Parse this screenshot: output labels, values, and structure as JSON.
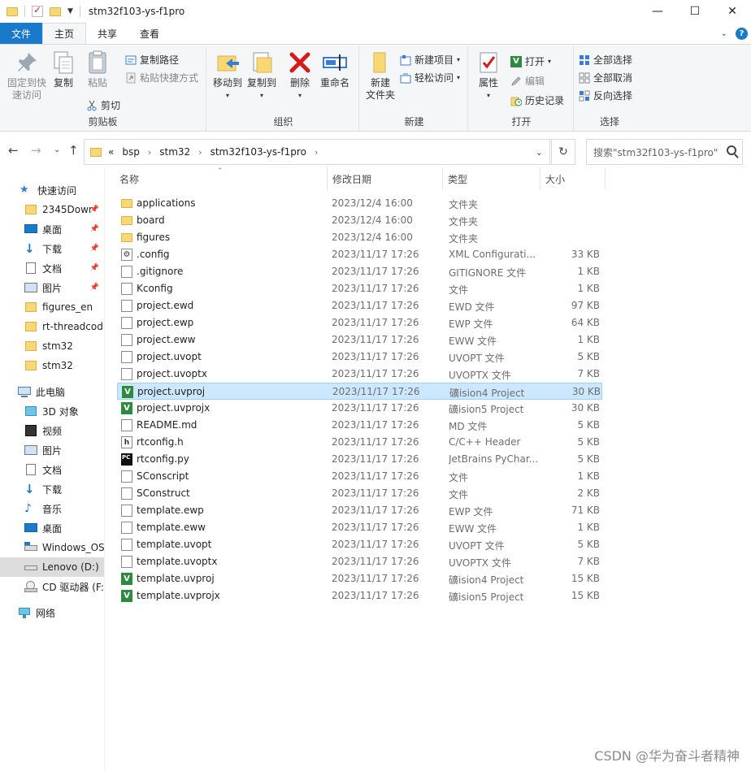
{
  "window": {
    "title": "stm32f103-ys-f1pro",
    "minimize": "—",
    "maximize": "☐",
    "close": "✕"
  },
  "ribbon_tabs": [
    {
      "label": "文件"
    },
    {
      "label": "主页"
    },
    {
      "label": "共享"
    },
    {
      "label": "查看"
    }
  ],
  "ribbon": {
    "clipboard": {
      "label": "剪贴板",
      "pin": "固定到快\n速访问",
      "copy": "复制",
      "paste": "粘贴",
      "copy_path": "复制路径",
      "paste_shortcut": "粘贴快捷方式",
      "cut": "剪切"
    },
    "organize": {
      "label": "组织",
      "move_to": "移动到",
      "copy_to": "复制到",
      "delete": "删除",
      "rename": "重命名"
    },
    "new": {
      "label": "新建",
      "new_folder": "新建\n文件夹",
      "new_item": "新建项目",
      "easy_access": "轻松访问"
    },
    "open": {
      "label": "打开",
      "properties": "属性",
      "open": "打开",
      "edit": "编辑",
      "history": "历史记录"
    },
    "select": {
      "label": "选择",
      "select_all": "全部选择",
      "select_none": "全部取消",
      "invert": "反向选择"
    }
  },
  "address": {
    "prefix": "«",
    "crumbs": [
      "bsp",
      "stm32",
      "stm32f103-ys-f1pro"
    ],
    "search_placeholder": "搜索\"stm32f103-ys-f1pro\""
  },
  "nav": {
    "items": [
      {
        "label": "快速访问",
        "icon": "star-icon",
        "pinned": false
      },
      {
        "label": "2345Dowr",
        "icon": "folder-icon",
        "pinned": true
      },
      {
        "label": "桌面",
        "icon": "desktop-icon",
        "pinned": true
      },
      {
        "label": "下载",
        "icon": "download-icon",
        "pinned": true
      },
      {
        "label": "文档",
        "icon": "documents-icon",
        "pinned": true
      },
      {
        "label": "图片",
        "icon": "pictures-icon",
        "pinned": true
      },
      {
        "label": "figures_en",
        "icon": "folder-icon",
        "pinned": false
      },
      {
        "label": "rt-threadcod",
        "icon": "folder-icon",
        "pinned": false
      },
      {
        "label": "stm32",
        "icon": "folder-icon",
        "pinned": false
      },
      {
        "label": "stm32",
        "icon": "folder-icon",
        "pinned": false
      },
      {
        "label": "此电脑",
        "icon": "computer-icon",
        "pinned": false
      },
      {
        "label": "3D 对象",
        "icon": "3d-objects-icon",
        "pinned": false
      },
      {
        "label": "视频",
        "icon": "video-icon",
        "pinned": false
      },
      {
        "label": "图片",
        "icon": "pictures-icon",
        "pinned": false
      },
      {
        "label": "文档",
        "icon": "documents-icon",
        "pinned": false
      },
      {
        "label": "下载",
        "icon": "download-icon",
        "pinned": false
      },
      {
        "label": "音乐",
        "icon": "music-icon",
        "pinned": false
      },
      {
        "label": "桌面",
        "icon": "desktop-icon",
        "pinned": false
      },
      {
        "label": "Windows_OS",
        "icon": "drive-icon",
        "pinned": false
      },
      {
        "label": "Lenovo (D:)",
        "icon": "drive-icon",
        "pinned": false
      },
      {
        "label": "CD 驱动器 (F:",
        "icon": "cd-drive-icon",
        "pinned": false
      },
      {
        "label": "网络",
        "icon": "network-icon",
        "pinned": false
      }
    ]
  },
  "columns": {
    "name": "名称",
    "date": "修改日期",
    "type": "类型",
    "size": "大小"
  },
  "files": [
    {
      "name": "applications",
      "date": "2023/12/4 16:00",
      "type": "文件夹",
      "size": "",
      "icon": "folder"
    },
    {
      "name": "board",
      "date": "2023/12/4 16:00",
      "type": "文件夹",
      "size": "",
      "icon": "folder"
    },
    {
      "name": "figures",
      "date": "2023/12/4 16:00",
      "type": "文件夹",
      "size": "",
      "icon": "folder"
    },
    {
      "name": ".config",
      "date": "2023/11/17 17:26",
      "type": "XML Configurati...",
      "size": "33 KB",
      "icon": "cfg"
    },
    {
      "name": ".gitignore",
      "date": "2023/11/17 17:26",
      "type": "GITIGNORE 文件",
      "size": "1 KB",
      "icon": "doc"
    },
    {
      "name": "Kconfig",
      "date": "2023/11/17 17:26",
      "type": "文件",
      "size": "1 KB",
      "icon": "doc"
    },
    {
      "name": "project.ewd",
      "date": "2023/11/17 17:26",
      "type": "EWD 文件",
      "size": "97 KB",
      "icon": "doc"
    },
    {
      "name": "project.ewp",
      "date": "2023/11/17 17:26",
      "type": "EWP 文件",
      "size": "64 KB",
      "icon": "doc"
    },
    {
      "name": "project.eww",
      "date": "2023/11/17 17:26",
      "type": "EWW 文件",
      "size": "1 KB",
      "icon": "doc"
    },
    {
      "name": "project.uvopt",
      "date": "2023/11/17 17:26",
      "type": "UVOPT 文件",
      "size": "5 KB",
      "icon": "doc"
    },
    {
      "name": "project.uvoptx",
      "date": "2023/11/17 17:26",
      "type": "UVOPTX 文件",
      "size": "7 KB",
      "icon": "doc"
    },
    {
      "name": "project.uvproj",
      "date": "2023/11/17 17:26",
      "type": "礦ision4 Project",
      "size": "30 KB",
      "icon": "keil",
      "selected": true
    },
    {
      "name": "project.uvprojx",
      "date": "2023/11/17 17:26",
      "type": "礦ision5 Project",
      "size": "30 KB",
      "icon": "keil"
    },
    {
      "name": "README.md",
      "date": "2023/11/17 17:26",
      "type": "MD 文件",
      "size": "5 KB",
      "icon": "doc"
    },
    {
      "name": "rtconfig.h",
      "date": "2023/11/17 17:26",
      "type": "C/C++ Header",
      "size": "5 KB",
      "icon": "h"
    },
    {
      "name": "rtconfig.py",
      "date": "2023/11/17 17:26",
      "type": "JetBrains PyChar...",
      "size": "5 KB",
      "icon": "pc"
    },
    {
      "name": "SConscript",
      "date": "2023/11/17 17:26",
      "type": "文件",
      "size": "1 KB",
      "icon": "doc"
    },
    {
      "name": "SConstruct",
      "date": "2023/11/17 17:26",
      "type": "文件",
      "size": "2 KB",
      "icon": "doc"
    },
    {
      "name": "template.ewp",
      "date": "2023/11/17 17:26",
      "type": "EWP 文件",
      "size": "71 KB",
      "icon": "doc"
    },
    {
      "name": "template.eww",
      "date": "2023/11/17 17:26",
      "type": "EWW 文件",
      "size": "1 KB",
      "icon": "doc"
    },
    {
      "name": "template.uvopt",
      "date": "2023/11/17 17:26",
      "type": "UVOPT 文件",
      "size": "5 KB",
      "icon": "doc"
    },
    {
      "name": "template.uvoptx",
      "date": "2023/11/17 17:26",
      "type": "UVOPTX 文件",
      "size": "7 KB",
      "icon": "doc"
    },
    {
      "name": "template.uvproj",
      "date": "2023/11/17 17:26",
      "type": "礦ision4 Project",
      "size": "15 KB",
      "icon": "keil"
    },
    {
      "name": "template.uvprojx",
      "date": "2023/11/17 17:26",
      "type": "礦ision5 Project",
      "size": "15 KB",
      "icon": "keil"
    }
  ],
  "watermark": "CSDN @华为奋斗者精神"
}
